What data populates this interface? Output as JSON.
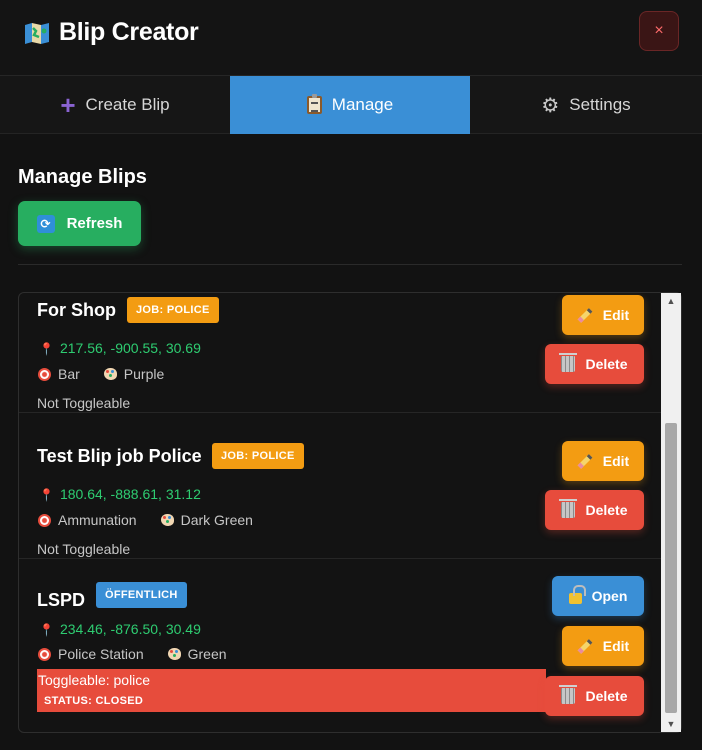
{
  "app": {
    "title": "Blip Creator",
    "close_label": "×"
  },
  "tabs": [
    {
      "label": "Create Blip",
      "icon": "plus-icon",
      "active": false
    },
    {
      "label": "Manage",
      "icon": "clipboard-icon",
      "active": true
    },
    {
      "label": "Settings",
      "icon": "gear-icon",
      "active": false
    }
  ],
  "manage": {
    "title": "Manage Blips",
    "refresh_label": "Refresh"
  },
  "blips": [
    {
      "name": "For Shop",
      "badge": "JOB: POLICE",
      "badge_type": "job",
      "coords": "217.56, -900.55, 30.69",
      "sprite": "Bar",
      "color": "Purple",
      "toggle": "Not Toggleable",
      "edit_label": "Edit",
      "delete_label": "Delete"
    },
    {
      "name": "Test Blip job Police",
      "badge": "JOB: POLICE",
      "badge_type": "job",
      "coords": "180.64, -888.61, 31.12",
      "sprite": "Ammunation",
      "color": "Dark Green",
      "toggle": "Not Toggleable",
      "edit_label": "Edit",
      "delete_label": "Delete"
    },
    {
      "name": "LSPD",
      "badge": "ÖFFENTLICH",
      "badge_type": "public",
      "coords": "234.46, -876.50, 30.49",
      "sprite": "Police Station",
      "color": "Green",
      "toggle": "Toggleable: police",
      "status": "STATUS: CLOSED",
      "open_label": "Open",
      "edit_label": "Edit",
      "delete_label": "Delete"
    }
  ],
  "colors": {
    "accent_blue": "#3a8fd6",
    "success_green": "#27ae60",
    "warning_orange": "#f39c12",
    "danger_red": "#e74c3c",
    "coords_green": "#2ecc71"
  }
}
